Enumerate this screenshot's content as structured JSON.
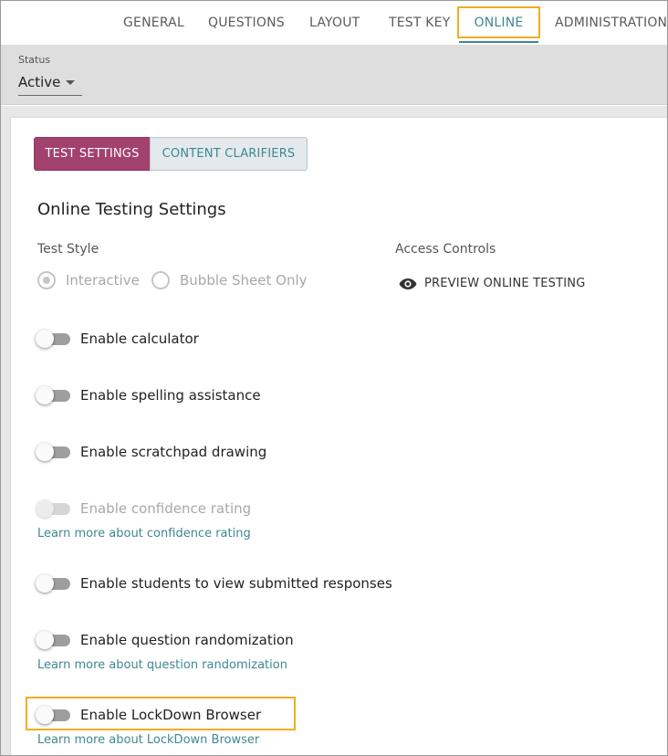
{
  "nav": {
    "tabs": [
      {
        "label": "GENERAL"
      },
      {
        "label": "QUESTIONS"
      },
      {
        "label": "LAYOUT"
      },
      {
        "label": "TEST KEY"
      },
      {
        "label": "ONLINE"
      },
      {
        "label": "ADMINISTRATION"
      }
    ],
    "active_tab": "ONLINE"
  },
  "status": {
    "label": "Status",
    "value": "Active"
  },
  "subtabs": {
    "test_settings": "TEST SETTINGS",
    "content_clarifiers": "CONTENT CLARIFIERS"
  },
  "settings": {
    "title": "Online Testing Settings",
    "test_style": {
      "label": "Test Style",
      "options": [
        "Interactive",
        "Bubble Sheet Only"
      ],
      "selected": "Interactive"
    },
    "access_controls": {
      "label": "Access Controls",
      "preview_label": "PREVIEW ONLINE TESTING"
    },
    "toggles": [
      {
        "label": "Enable calculator",
        "on": false,
        "disabled": false
      },
      {
        "label": "Enable spelling assistance",
        "on": false,
        "disabled": false
      },
      {
        "label": "Enable scratchpad drawing",
        "on": false,
        "disabled": false
      },
      {
        "label": "Enable confidence rating",
        "on": false,
        "disabled": true
      },
      {
        "label": "Enable students to view submitted responses",
        "on": false,
        "disabled": false
      },
      {
        "label": "Enable question randomization",
        "on": false,
        "disabled": false
      },
      {
        "label": "Enable LockDown Browser",
        "on": false,
        "disabled": false
      }
    ],
    "links": {
      "confidence": "Learn more about confidence rating",
      "randomization": "Learn more about question randomization",
      "lockdown": "Learn more about LockDown Browser"
    }
  },
  "colors": {
    "accent_teal": "#3f8791",
    "active_subtab": "#a3416e",
    "highlight_box": "#f0ad22"
  }
}
